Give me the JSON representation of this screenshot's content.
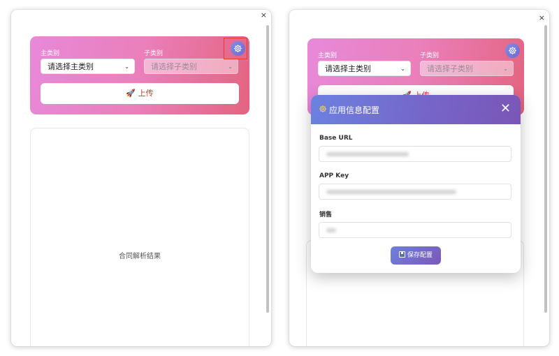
{
  "left_window": {
    "close_symbol": "×",
    "main_category_label": "主类别",
    "main_category_placeholder": "请选择主类别",
    "sub_category_label": "子类别",
    "sub_category_placeholder": "请选择子类别",
    "upload_label": "🚀 上传",
    "result_placeholder": "合同解析结果",
    "settings_icon": "gear-icon"
  },
  "right_window": {
    "close_symbol": "×",
    "main_category_label": "主类别",
    "main_category_placeholder": "请选择主类别",
    "sub_category_label": "子类别",
    "sub_category_placeholder": "请选择子类别",
    "upload_label": "🚀 上传",
    "settings_icon": "gear-icon",
    "modal": {
      "title": "应用信息配置",
      "close_symbol": "✕",
      "fields": [
        {
          "label": "Base URL"
        },
        {
          "label": "APP Key"
        },
        {
          "label": "销售"
        }
      ],
      "save_label": "保存配置"
    }
  },
  "colors": {
    "hero_gradient_start": "#e889d9",
    "hero_gradient_end": "#e36480",
    "modal_header_start": "#6b82e0",
    "modal_header_end": "#7a56b6",
    "upload_text": "#d53939",
    "highlight_box": "#e03a3a"
  }
}
